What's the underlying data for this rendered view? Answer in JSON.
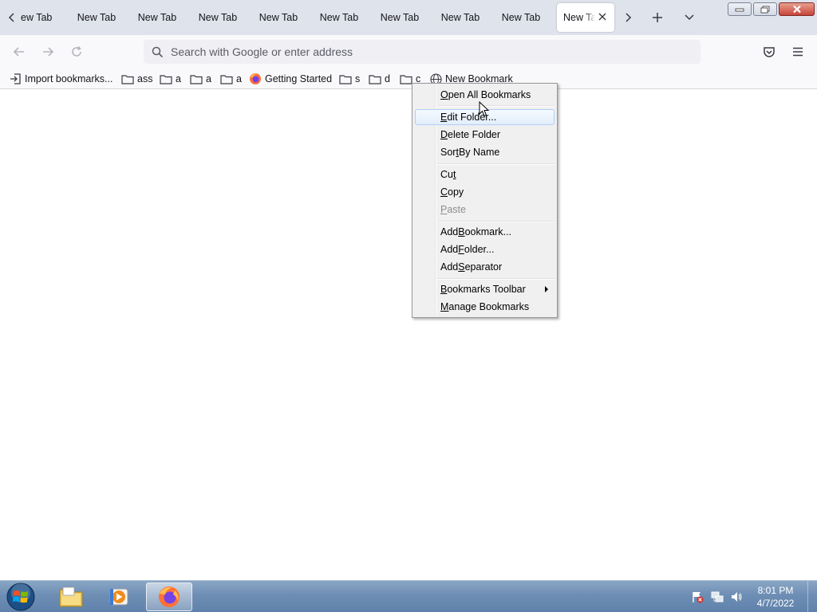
{
  "tabs": {
    "partial_first": "ew Tab",
    "items": [
      "New Tab",
      "New Tab",
      "New Tab",
      "New Tab",
      "New Tab",
      "New Tab",
      "New Tab",
      "New Tab"
    ],
    "active": "New Tab"
  },
  "navbar": {
    "search_placeholder": "Search with Google or enter address"
  },
  "bookmarks": {
    "import": "Import bookmarks...",
    "items": [
      "ass",
      "a",
      "a",
      "a",
      "Getting Started",
      "s",
      "d",
      "c",
      "New Bookmark"
    ]
  },
  "context_menu": {
    "items": [
      {
        "pre": "",
        "u": "O",
        "post": "pen All Bookmarks"
      },
      {
        "pre": "",
        "u": "E",
        "post": "dit Folder..."
      },
      {
        "pre": "",
        "u": "D",
        "post": "elete Folder"
      },
      {
        "pre": "Sor",
        "u": "t",
        "post": " By Name"
      },
      {
        "pre": "Cu",
        "u": "t",
        "post": ""
      },
      {
        "pre": "",
        "u": "C",
        "post": "opy"
      },
      {
        "pre": "",
        "u": "P",
        "post": "aste"
      },
      {
        "pre": "Add ",
        "u": "B",
        "post": "ookmark..."
      },
      {
        "pre": "Add ",
        "u": "F",
        "post": "older..."
      },
      {
        "pre": "Add ",
        "u": "S",
        "post": "eparator"
      },
      {
        "pre": "",
        "u": "B",
        "post": "ookmarks Toolbar"
      },
      {
        "pre": "",
        "u": "M",
        "post": "anage Bookmarks"
      }
    ]
  },
  "taskbar": {
    "time": "8:01 PM",
    "date": "4/7/2022"
  },
  "colors": {
    "tabstrip_bg": "#dfe3ec",
    "toolbar_bg": "#f9f9fb",
    "menu_bg": "#f0f0f0",
    "taskbar_bg": "#6e8eb4"
  }
}
